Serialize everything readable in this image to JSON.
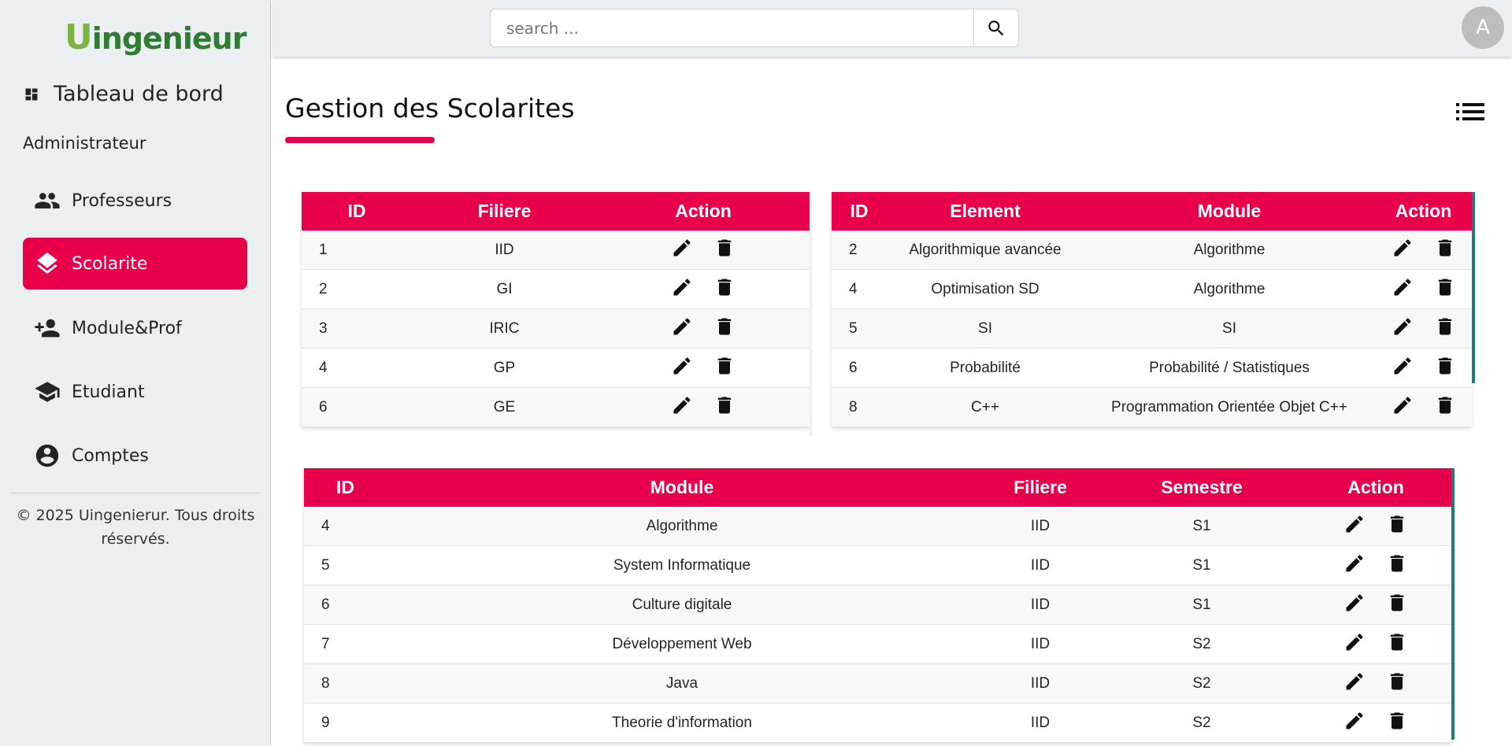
{
  "sidebar": {
    "logo_mark": "U",
    "logo_text": "ingenieur",
    "dashboard_label": "Tableau de bord",
    "section_label": "Administrateur",
    "items": [
      {
        "label": "Professeurs",
        "icon": "people-icon"
      },
      {
        "label": "Scolarite",
        "icon": "layers-icon",
        "active": true
      },
      {
        "label": "Module&Prof",
        "icon": "person-add-icon"
      },
      {
        "label": "Etudiant",
        "icon": "school-icon"
      },
      {
        "label": "Comptes",
        "icon": "account-circle-icon"
      }
    ],
    "copyright": "© 2025 Uingenierur. Tous droits réservés."
  },
  "topbar": {
    "search_placeholder": "search ...",
    "avatar_letter": "A"
  },
  "main": {
    "title": "Gestion des Scolarites"
  },
  "filieres_table": {
    "headers": [
      "ID",
      "Filiere",
      "Action"
    ],
    "rows": [
      {
        "id": "1",
        "filiere": "IID"
      },
      {
        "id": "2",
        "filiere": "GI"
      },
      {
        "id": "3",
        "filiere": "IRIC"
      },
      {
        "id": "4",
        "filiere": "GP"
      },
      {
        "id": "6",
        "filiere": "GE"
      }
    ]
  },
  "elements_table": {
    "headers": [
      "ID",
      "Element",
      "Module",
      "Action"
    ],
    "rows": [
      {
        "id": "2",
        "element": "Algorithmique avancée",
        "module": "Algorithme"
      },
      {
        "id": "4",
        "element": "Optimisation SD",
        "module": "Algorithme"
      },
      {
        "id": "5",
        "element": "SI",
        "module": "SI"
      },
      {
        "id": "6",
        "element": "Probabilité",
        "module": "Probabilité / Statistiques"
      },
      {
        "id": "8",
        "element": "C++",
        "module": "Programmation Orientée Objet C++"
      }
    ]
  },
  "modules_table": {
    "headers": [
      "ID",
      "Module",
      "Filiere",
      "Semestre",
      "Action"
    ],
    "rows": [
      {
        "id": "4",
        "module": "Algorithme",
        "filiere": "IID",
        "semestre": "S1"
      },
      {
        "id": "5",
        "module": "System Informatique",
        "filiere": "IID",
        "semestre": "S1"
      },
      {
        "id": "6",
        "module": "Culture digitale",
        "filiere": "IID",
        "semestre": "S1"
      },
      {
        "id": "7",
        "module": "Développement Web",
        "filiere": "IID",
        "semestre": "S2"
      },
      {
        "id": "8",
        "module": "Java",
        "filiere": "IID",
        "semestre": "S2"
      },
      {
        "id": "9",
        "module": "Theorie d'information",
        "filiere": "IID",
        "semestre": "S2"
      }
    ]
  },
  "colors": {
    "accent": "#e8004d",
    "sidebar_bg": "#eceff1",
    "scrollbar": "#1f7a7a"
  }
}
